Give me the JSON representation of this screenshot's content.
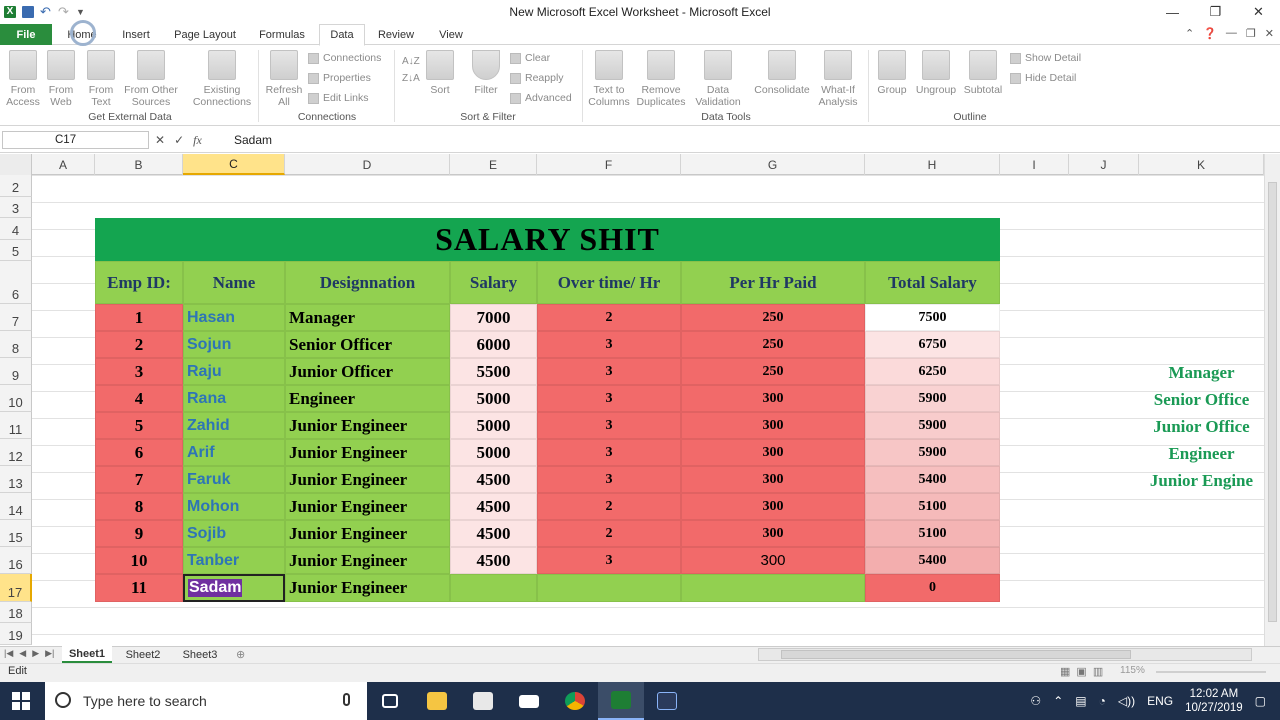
{
  "window": {
    "title": "New Microsoft Excel Worksheet - Microsoft Excel",
    "excel_icon": "X"
  },
  "tabs": {
    "file": "File",
    "home": "Home",
    "insert": "Insert",
    "page_layout": "Page Layout",
    "formulas": "Formulas",
    "data": "Data",
    "review": "Review",
    "view": "View"
  },
  "ribbon": {
    "get_external": {
      "label": "Get External Data",
      "from_access": "From\nAccess",
      "from_web": "From\nWeb",
      "from_text": "From\nText",
      "from_other": "From Other\nSources",
      "existing": "Existing\nConnections"
    },
    "connections": {
      "label": "Connections",
      "refresh_all": "Refresh\nAll",
      "connections": "Connections",
      "properties": "Properties",
      "edit_links": "Edit Links"
    },
    "sort_filter": {
      "label": "Sort & Filter",
      "sort": "Sort",
      "filter": "Filter",
      "clear": "Clear",
      "reapply": "Reapply",
      "advanced": "Advanced"
    },
    "data_tools": {
      "label": "Data Tools",
      "text_to_columns": "Text to\nColumns",
      "remove_duplicates": "Remove\nDuplicates",
      "data_validation": "Data\nValidation",
      "consolidate": "Consolidate",
      "what_if": "What-If\nAnalysis"
    },
    "outline": {
      "label": "Outline",
      "group": "Group",
      "ungroup": "Ungroup",
      "subtotal": "Subtotal",
      "show_detail": "Show Detail",
      "hide_detail": "Hide Detail"
    }
  },
  "formula_bar": {
    "name_box": "C17",
    "content": "Sadam"
  },
  "columns": [
    "A",
    "B",
    "C",
    "D",
    "E",
    "F",
    "G",
    "H",
    "I",
    "J",
    "K"
  ],
  "rows": [
    "2",
    "3",
    "4",
    "5",
    "6",
    "7",
    "8",
    "9",
    "10",
    "11",
    "12",
    "13",
    "14",
    "15",
    "16",
    "17",
    "18",
    "19"
  ],
  "sheet": {
    "title": "SALARY SHIT",
    "headers": [
      "Emp ID:",
      "Name",
      "Designnation",
      "Salary",
      "Over time/ Hr",
      "Per Hr Paid",
      "Total Salary"
    ],
    "records": [
      [
        "1",
        "Hasan",
        "Manager",
        "7000",
        "2",
        "250",
        "7500"
      ],
      [
        "2",
        "Sojun",
        "Senior Officer",
        "6000",
        "3",
        "250",
        "6750"
      ],
      [
        "3",
        "Raju",
        "Junior Officer",
        "5500",
        "3",
        "250",
        "6250"
      ],
      [
        "4",
        "Rana",
        "Engineer",
        "5000",
        "3",
        "300",
        "5900"
      ],
      [
        "5",
        "Zahid",
        "Junior Engineer",
        "5000",
        "3",
        "300",
        "5900"
      ],
      [
        "6",
        "Arif",
        "Junior Engineer",
        "5000",
        "3",
        "300",
        "5900"
      ],
      [
        "7",
        "Faruk",
        "Junior Engineer",
        "4500",
        "3",
        "300",
        "5400"
      ],
      [
        "8",
        "Mohon",
        "Junior Engineer",
        "4500",
        "2",
        "300",
        "5100"
      ],
      [
        "9",
        "Sojib",
        "Junior Engineer",
        "4500",
        "2",
        "300",
        "5100"
      ],
      [
        "10",
        "Tanber",
        "Junior Engineer",
        "4500",
        "3",
        "300",
        "5400"
      ],
      [
        "11",
        "Sadam",
        "Junior Engineer",
        "",
        "",
        "",
        "0"
      ]
    ],
    "side_list": [
      "Manager",
      "Senior Office",
      "Junior Office",
      "Engineer",
      "Junior Engine"
    ]
  },
  "sheet_tabs": [
    "Sheet1",
    "Sheet2",
    "Sheet3"
  ],
  "status": {
    "mode": "Edit",
    "zoom": "115%"
  },
  "taskbar": {
    "search_placeholder": "Type here to search",
    "lang": "ENG",
    "time": "12:02 AM",
    "date": "10/27/2019"
  }
}
